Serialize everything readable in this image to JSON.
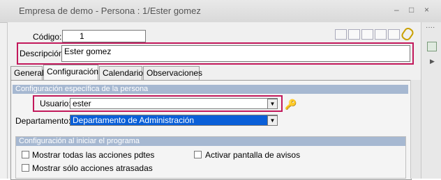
{
  "window": {
    "title": "Empresa de demo - Persona : 1/Ester gomez",
    "min": "–",
    "max": "□",
    "close": "×"
  },
  "side": {
    "dots": "····",
    "arrow": "▶"
  },
  "form": {
    "codigo_label": "Código:",
    "codigo_value": "1",
    "descripcion_label": "Descripción:",
    "descripcion_value": "Ester gomez"
  },
  "tabs": [
    {
      "label": "General"
    },
    {
      "label": "Configuración"
    },
    {
      "label": "Calendario"
    },
    {
      "label": "Observaciones"
    }
  ],
  "config": {
    "section_title": "Configuración específica de la persona",
    "usuario_label": "Usuario:",
    "usuario_value": "ester",
    "departamento_label": "Departamento:",
    "departamento_value": "Departamento de Administración"
  },
  "inicio": {
    "section_title": "Configuración al iniciar el programa",
    "options": [
      {
        "label": "Mostrar todas las acciones pdtes",
        "checked": false
      },
      {
        "label": "Mostrar sólo acciones atrasadas",
        "checked": false
      },
      {
        "label": "Activar pantalla de avisos",
        "checked": false
      }
    ]
  },
  "icons": {
    "combo_arrow": "▼",
    "key": "🔑"
  }
}
